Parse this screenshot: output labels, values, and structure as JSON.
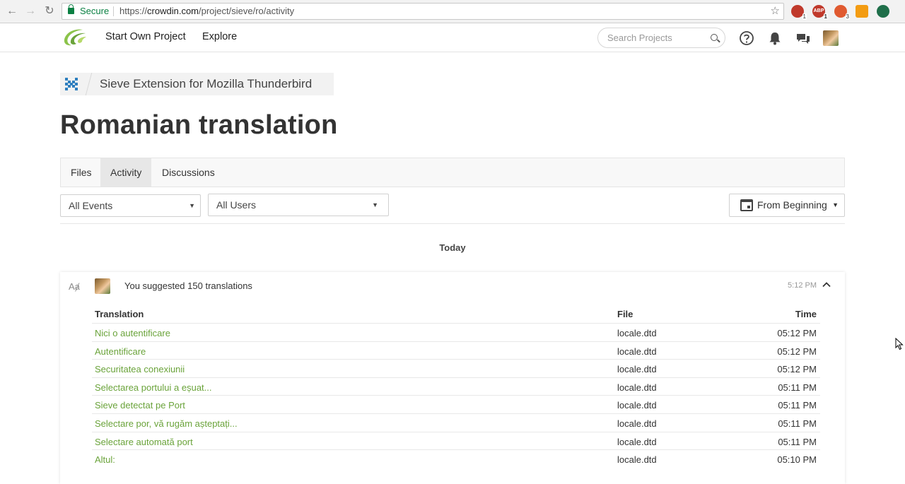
{
  "browser": {
    "secure_label": "Secure",
    "url_scheme": "https://",
    "url_host": "crowdin.com",
    "url_path": "/project/sieve/ro/activity",
    "extensions": [
      {
        "name": "ublock",
        "color": "#c0392b",
        "badge": "1"
      },
      {
        "name": "abp",
        "color": "#c0392b",
        "badge": "1",
        "text": "ABP"
      },
      {
        "name": "ext3",
        "color": "#e05a30",
        "badge": "3"
      },
      {
        "name": "ext4",
        "color": "#f39c12",
        "badge": ""
      },
      {
        "name": "ext5",
        "color": "#1f6f4a",
        "badge": ""
      }
    ]
  },
  "header": {
    "nav": [
      "Start Own Project",
      "Explore"
    ],
    "search_placeholder": "Search Projects"
  },
  "breadcrumb": {
    "project": "Sieve Extension for Mozilla Thunderbird"
  },
  "page_title": "Romanian translation",
  "tabs": [
    {
      "label": "Files",
      "active": false
    },
    {
      "label": "Activity",
      "active": true
    },
    {
      "label": "Discussions",
      "active": false
    }
  ],
  "filters": {
    "events": "All Events",
    "users": "All Users",
    "date": "From Beginning"
  },
  "day_label": "Today",
  "activity": {
    "summary": "You suggested 150 translations",
    "time": "5:12 PM",
    "columns": {
      "translation": "Translation",
      "file": "File",
      "time": "Time"
    },
    "rows": [
      {
        "translation": "Nici o autentificare",
        "file": "locale.dtd",
        "time": "05:12 PM"
      },
      {
        "translation": "Autentificare",
        "file": "locale.dtd",
        "time": "05:12 PM"
      },
      {
        "translation": "Securitatea conexiunii",
        "file": "locale.dtd",
        "time": "05:12 PM"
      },
      {
        "translation": "Selectarea portului a eșuat...",
        "file": "locale.dtd",
        "time": "05:11 PM"
      },
      {
        "translation": "Sieve detectat pe Port",
        "file": "locale.dtd",
        "time": "05:11 PM"
      },
      {
        "translation": "Selectare por, vă rugăm așteptați...",
        "file": "locale.dtd",
        "time": "05:11 PM"
      },
      {
        "translation": "Selectare automată port",
        "file": "locale.dtd",
        "time": "05:11 PM"
      },
      {
        "translation": "Altul:",
        "file": "locale.dtd",
        "time": "05:10 PM"
      }
    ]
  },
  "colors": {
    "accent_green": "#6aa33a",
    "logo_green": "#8bc34a"
  }
}
